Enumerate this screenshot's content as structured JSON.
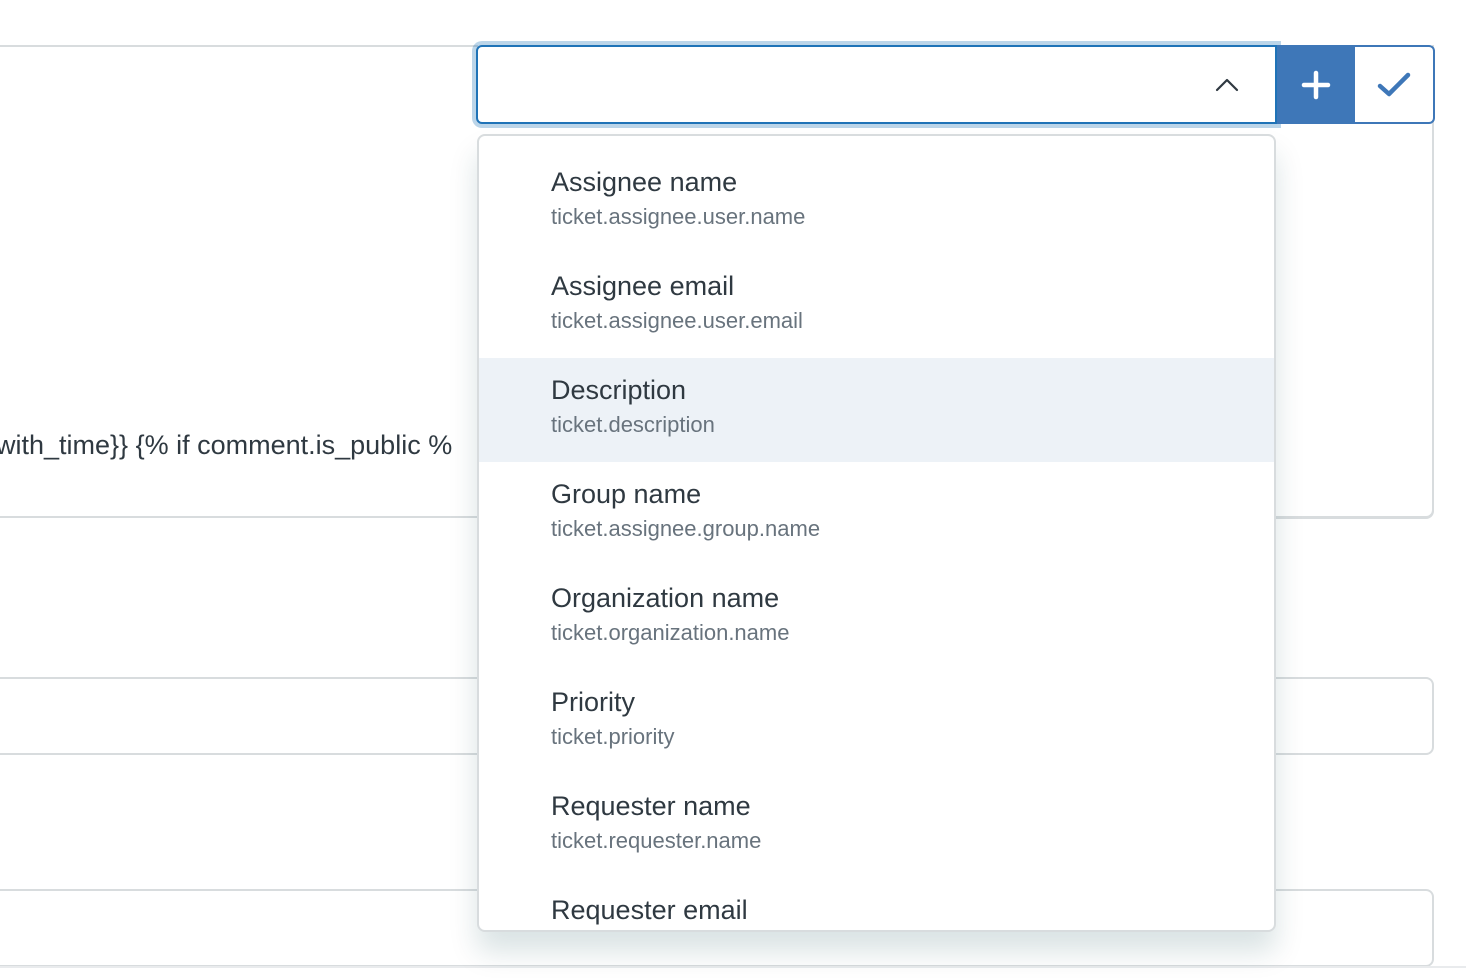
{
  "background": {
    "template_snippet": "with_time}} {% if comment.is_public %"
  },
  "combobox": {
    "value": "",
    "expanded": true,
    "toggle_icon": "chevron-up-icon"
  },
  "buttons": {
    "add_icon": "plus-icon",
    "confirm_icon": "checkmark-icon"
  },
  "colors": {
    "accent": "#1f73b7",
    "button_blue": "#3e77b8",
    "hover_row": "#edf2f7",
    "hint_text": "#68737d"
  },
  "menu": {
    "items": [
      {
        "label": "Assignee name",
        "hint": "ticket.assignee.user.name",
        "hovered": false
      },
      {
        "label": "Assignee email",
        "hint": "ticket.assignee.user.email",
        "hovered": false
      },
      {
        "label": "Description",
        "hint": "ticket.description",
        "hovered": true
      },
      {
        "label": "Group name",
        "hint": "ticket.assignee.group.name",
        "hovered": false
      },
      {
        "label": "Organization name",
        "hint": "ticket.organization.name",
        "hovered": false
      },
      {
        "label": "Priority",
        "hint": "ticket.priority",
        "hovered": false
      },
      {
        "label": "Requester name",
        "hint": "ticket.requester.name",
        "hovered": false
      },
      {
        "label": "Requester email",
        "hint": "",
        "hovered": false
      }
    ]
  }
}
